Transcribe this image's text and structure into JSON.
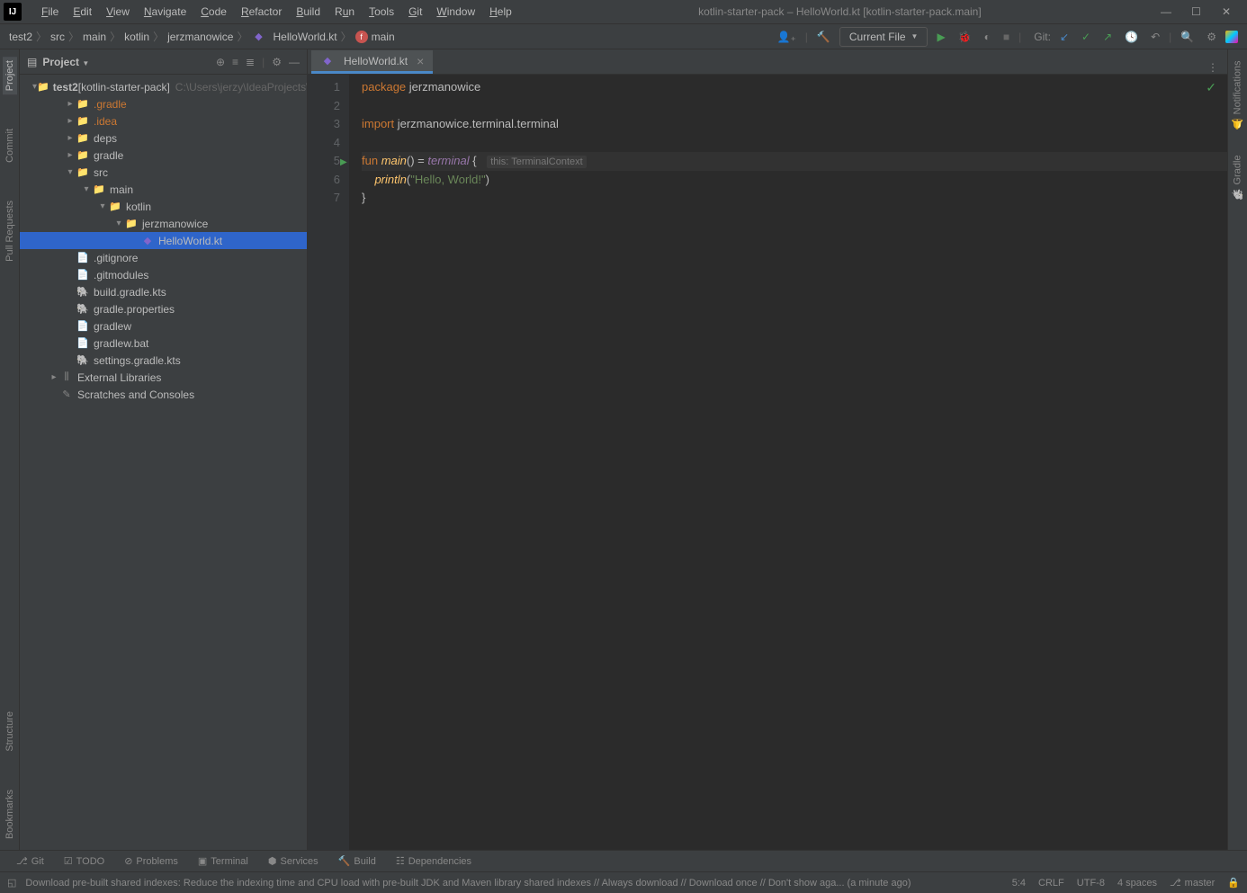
{
  "titlebar": {
    "app": "IJ",
    "menu": [
      "File",
      "Edit",
      "View",
      "Navigate",
      "Code",
      "Refactor",
      "Build",
      "Run",
      "Tools",
      "Git",
      "Window",
      "Help"
    ],
    "title": "kotlin-starter-pack – HelloWorld.kt [kotlin-starter-pack.main]"
  },
  "breadcrumb": [
    "test2",
    "src",
    "main",
    "kotlin",
    "jerzmanowice",
    "HelloWorld.kt",
    "main"
  ],
  "nav": {
    "run_config": "Current File",
    "git_label": "Git:"
  },
  "left_gutter": [
    "Project",
    "Commit",
    "Pull Requests",
    "Structure",
    "Bookmarks"
  ],
  "right_gutter": [
    "Notifications",
    "Gradle"
  ],
  "project_panel": {
    "title": "Project",
    "root": {
      "label": "test2",
      "suffix": "[kotlin-starter-pack]",
      "hint": "C:\\Users\\jerzy\\IdeaProjects\\te"
    },
    "items": [
      {
        "indent": 1,
        "arrow": ">",
        "icon": "folder",
        "label": ".gradle",
        "style": "orange"
      },
      {
        "indent": 1,
        "arrow": ">",
        "icon": "folder",
        "label": ".idea",
        "style": "orange"
      },
      {
        "indent": 1,
        "arrow": ">",
        "icon": "folder",
        "label": "deps"
      },
      {
        "indent": 1,
        "arrow": ">",
        "icon": "folder",
        "label": "gradle"
      },
      {
        "indent": 1,
        "arrow": "v",
        "icon": "source",
        "label": "src"
      },
      {
        "indent": 2,
        "arrow": "v",
        "icon": "source",
        "label": "main"
      },
      {
        "indent": 3,
        "arrow": "v",
        "icon": "package",
        "label": "kotlin"
      },
      {
        "indent": 4,
        "arrow": "v",
        "icon": "package",
        "label": "jerzmanowice"
      },
      {
        "indent": 5,
        "arrow": "",
        "icon": "kotlin",
        "label": "HelloWorld.kt",
        "selected": true
      },
      {
        "indent": 1,
        "arrow": "",
        "icon": "file",
        "label": ".gitignore"
      },
      {
        "indent": 1,
        "arrow": "",
        "icon": "file",
        "label": ".gitmodules"
      },
      {
        "indent": 1,
        "arrow": "",
        "icon": "gradle",
        "label": "build.gradle.kts"
      },
      {
        "indent": 1,
        "arrow": "",
        "icon": "gradle",
        "label": "gradle.properties"
      },
      {
        "indent": 1,
        "arrow": "",
        "icon": "file",
        "label": "gradlew"
      },
      {
        "indent": 1,
        "arrow": "",
        "icon": "file",
        "label": "gradlew.bat"
      },
      {
        "indent": 1,
        "arrow": "",
        "icon": "gradle",
        "label": "settings.gradle.kts"
      },
      {
        "indent": 0,
        "arrow": ">",
        "icon": "lib",
        "label": "External Libraries"
      },
      {
        "indent": 0,
        "arrow": "",
        "icon": "scratch",
        "label": "Scratches and Consoles"
      }
    ]
  },
  "tab": {
    "name": "HelloWorld.kt"
  },
  "code": {
    "lines": [
      "1",
      "2",
      "3",
      "4",
      "5",
      "6",
      "7"
    ],
    "l1_kw": "package ",
    "l1_id": "jerzmanowice",
    "l3_kw": "import ",
    "l3_id": "jerzmanowice.terminal.terminal",
    "l5_kw": "fun ",
    "l5_fn": "main",
    "l5_rest": "() = ",
    "l5_term": "terminal",
    "l5_brace": " { ",
    "l5_hint": "this: TerminalContext",
    "l6_indent": "    ",
    "l6_print": "println",
    "l6_paren": "(",
    "l6_str": "\"Hello, World!\"",
    "l6_close": ")",
    "l7": "}"
  },
  "bottom_tools": [
    "Git",
    "TODO",
    "Problems",
    "Terminal",
    "Services",
    "Build",
    "Dependencies"
  ],
  "status": {
    "msg": "Download pre-built shared indexes: Reduce the indexing time and CPU load with pre-built JDK and Maven library shared indexes // Always download // Download once // Don't show aga... (a minute ago)",
    "pos": "5:4",
    "eol": "CRLF",
    "enc": "UTF-8",
    "indent": "4 spaces",
    "branch": "master"
  }
}
